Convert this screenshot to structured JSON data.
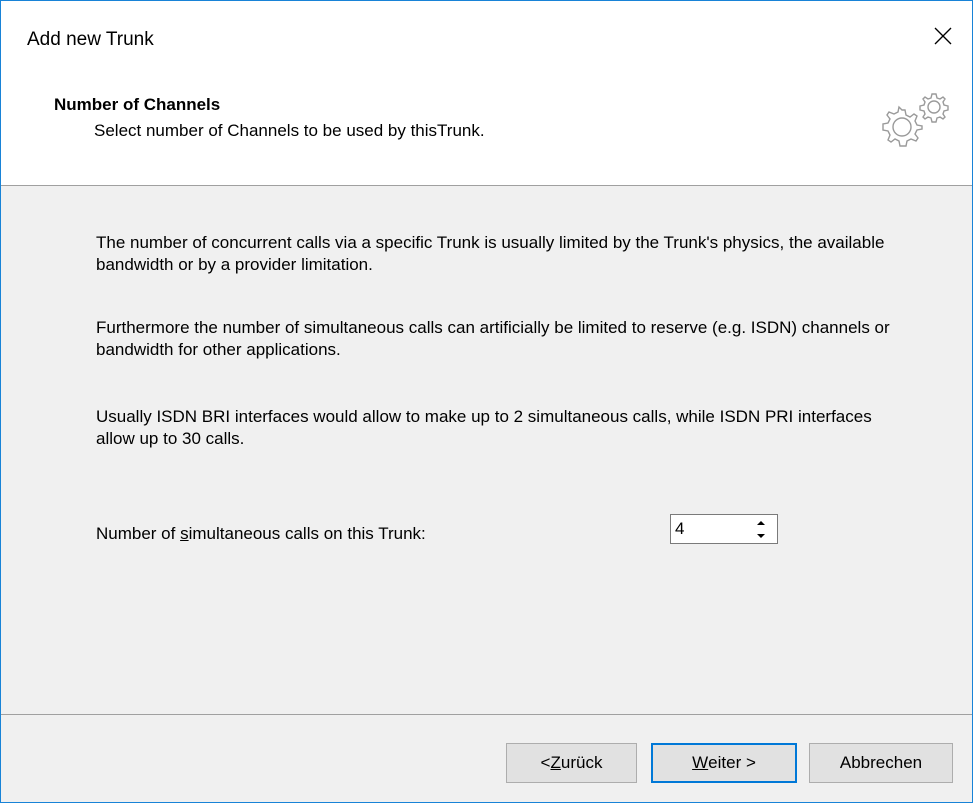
{
  "window": {
    "title": "Add new Trunk",
    "close_icon": "close-icon",
    "accent_color": "#0078d7"
  },
  "header": {
    "title": "Number of Channels",
    "subtitle": "Select number of Channels to be used by thisTrunk.",
    "icon": "gears-icon"
  },
  "content": {
    "paragraphs": [
      "The number of concurrent calls via a specific Trunk is usually limited by the Trunk's physics, the available bandwidth or by a provider limitation.",
      "Furthermore the number of simultaneous calls can artificially be limited to reserve (e.g. ISDN) channels or bandwidth for other applications.",
      "Usually ISDN BRI interfaces would allow to make up to 2 simultaneous calls, while ISDN PRI interfaces allow up to 30 calls."
    ],
    "field_label_pre": "Number of ",
    "field_label_mnemonic": "s",
    "field_label_post": "imultaneous calls on this Trunk:",
    "spinner_value": "4"
  },
  "buttons": {
    "back_pre": "< ",
    "back_mnemonic": "Z",
    "back_post": "urück",
    "next_mnemonic": "W",
    "next_post": "eiter >",
    "cancel": "Abbrechen"
  }
}
